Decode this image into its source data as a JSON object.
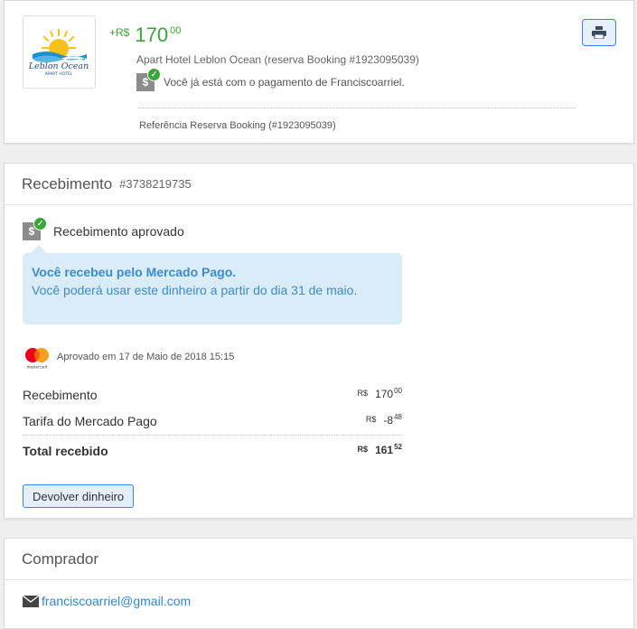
{
  "operation": {
    "amount_prefix": "+R$",
    "amount_int": "170",
    "amount_cents": "00",
    "description": "Apart Hotel Leblon Ocean (reserva Booking #1923095039)",
    "payment_status": "Você já está com o pagamento de Franciscoarriel.",
    "reference": "Referência Reserva Booking (#1923095039)",
    "logo_text_1": "Leblon Ocean",
    "logo_text_2": "APART HOTEL",
    "print_icon": "print-icon"
  },
  "receipt": {
    "title": "Recebimento",
    "id": "#3738219735",
    "status": "Recebimento aprovado",
    "info_bold": "Você recebeu pelo Mercado Pago.",
    "info_text": "Você poderá usar este dinheiro a partir do dia 31 de maio.",
    "card_brand": "mastercard",
    "approved_date": "Aprovado em 17 de Maio de 2018 15:15",
    "rows": [
      {
        "label": "Recebimento",
        "currency": "R$",
        "int": "170",
        "cents": "00"
      },
      {
        "label": "Tarifa do Mercado Pago",
        "currency": "R$",
        "int": "-8",
        "cents": "48"
      },
      {
        "label": "Total recebido",
        "currency": "R$",
        "int": "161",
        "cents": "52"
      }
    ],
    "refund_button": "Devolver dinheiro"
  },
  "buyer": {
    "title": "Comprador",
    "email": "franciscoarriel@gmail.com"
  },
  "colors": {
    "green": "#3aa635",
    "blue_link": "#2f87d9",
    "info_bg": "#d9ecf7",
    "button_border": "#3483fa"
  }
}
